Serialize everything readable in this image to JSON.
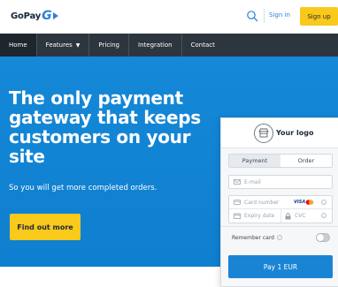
{
  "header": {
    "logo_text": "GoPay",
    "logo_letter": "G",
    "sign_in": "Sign in",
    "sign_up": "Sign up"
  },
  "nav": {
    "items": [
      {
        "label": "Home",
        "active": true
      },
      {
        "label": "Features",
        "has_dropdown": true
      },
      {
        "label": "Pricing"
      },
      {
        "label": "Integration"
      },
      {
        "label": "Contact"
      }
    ],
    "dropdown_caret": "▼"
  },
  "hero": {
    "title": "The only payment gateway that keeps customers on your site",
    "subtitle": "So you will get more completed orders.",
    "cta": "Find out more"
  },
  "payment_form": {
    "logo_text": "Your logo",
    "tabs": [
      {
        "label": "Payment",
        "active": true
      },
      {
        "label": "Order",
        "active": false
      }
    ],
    "email_placeholder": "E-mail",
    "card_number_placeholder": "Card number",
    "card_brand_visa": "VISA",
    "expiry_placeholder": "Expiry date",
    "cvc_placeholder": "CVC",
    "remember_label": "Remember card",
    "remember_enabled": false,
    "pay_button": "Pay 1 EUR",
    "info_symbol": "i"
  },
  "colors": {
    "brand_blue": "#1486d6",
    "accent_yellow": "#f9c91c",
    "nav_dark": "#2d363f",
    "nav_active": "#1d252d"
  }
}
